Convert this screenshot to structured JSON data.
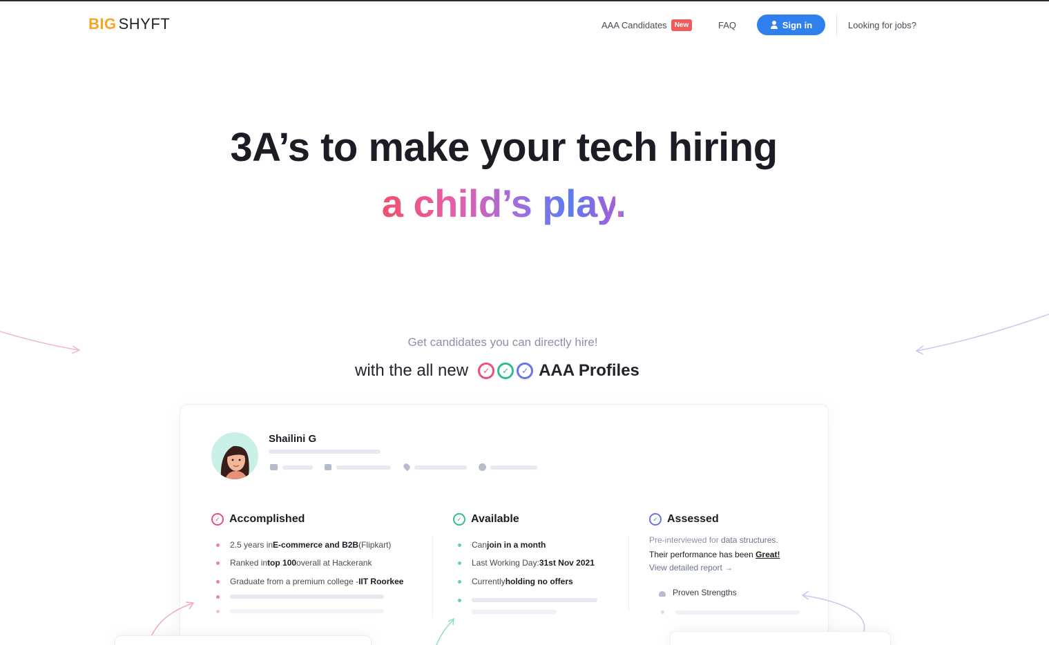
{
  "header": {
    "logo_big": "BIG",
    "logo_shyft": "SHYFT",
    "nav_aaa_label": "AAA Candidates",
    "nav_aaa_badge": "New",
    "nav_faq_label": "FAQ",
    "signin_label": "Sign in",
    "nav_jobs_label": "Looking for jobs?"
  },
  "hero": {
    "line1": "3A’s to make your tech hiring",
    "line2": "a child’s play",
    "line2_dot": "."
  },
  "intro": {
    "subtitle": "Get candidates you can directly hire!",
    "with_text": "with the all new",
    "profiles_label": "AAA Profiles"
  },
  "profile": {
    "name": "Shailini G",
    "accomplished": {
      "title": "Accomplished",
      "items": [
        {
          "pre": "2.5 years in ",
          "bold": "E-commerce and B2B",
          "post": " (Flipkart)"
        },
        {
          "pre": "Ranked in ",
          "bold": "top 100",
          "post": " overall at Hackerank"
        },
        {
          "pre": "Graduate from a premium college - ",
          "bold": "IIT Roorkee",
          "post": ""
        }
      ]
    },
    "available": {
      "title": "Available",
      "items": [
        {
          "pre": "Can ",
          "bold": "join in a month",
          "post": ""
        },
        {
          "pre": "Last Working Day: ",
          "bold": "31st Nov 2021",
          "post": ""
        },
        {
          "pre": "Currently ",
          "bold": "holding no offers",
          "post": ""
        }
      ]
    },
    "assessed": {
      "title": "Assessed",
      "line1_pre": "Pre-interviewed for ",
      "line1_bold": "data structures.",
      "line2_pre": "Their performance has been ",
      "line2_bold": "Great!",
      "report_link": "View detailed report →",
      "strengths_label": "Proven Strengths"
    }
  },
  "colors": {
    "brand_orange": "#f5a524",
    "signin_blue": "#2f80ed",
    "badge_red": "#f05a5a",
    "accomplished_pink": "#ef4d7a",
    "available_green": "#2fbf8a",
    "assessed_blue": "#6b74e8"
  },
  "icons": [
    "user-icon",
    "check-ring-icon",
    "briefcase-icon",
    "wallet-icon",
    "location-icon",
    "clock-icon",
    "arm-icon"
  ]
}
